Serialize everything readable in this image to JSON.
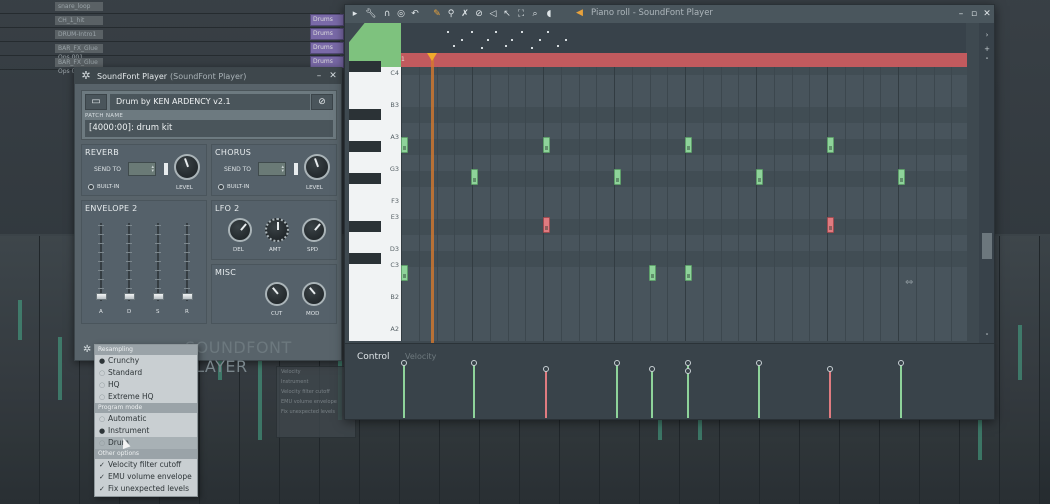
{
  "sfp": {
    "title": "SoundFont Player",
    "subtitle": "(SoundFont Player)",
    "soundfont_name": "Drum by KEN ARDENCY v2.1",
    "patch_label": "PATCH NAME",
    "patch_value": "[4000:00]: drum kit",
    "reverb": {
      "header": "REVERB",
      "send_to": "SEND TO",
      "builtin": "BUILT-IN",
      "level": "LEVEL"
    },
    "chorus": {
      "header": "CHORUS",
      "send_to": "SEND TO",
      "builtin": "BUILT-IN",
      "level": "LEVEL"
    },
    "envelope": {
      "header": "ENVELOPE 2",
      "labels": [
        "A",
        "D",
        "S",
        "R"
      ]
    },
    "lfo": {
      "header": "LFO 2",
      "knobs": [
        "DEL",
        "AMT",
        "SPD"
      ]
    },
    "misc": {
      "header": "MISC",
      "knobs": [
        "CUT",
        "MOD"
      ]
    },
    "brand_a": "SOUNDFONT",
    "brand_b": "PLAYER"
  },
  "menu": {
    "sections": [
      {
        "header": "Resampling",
        "items": [
          {
            "label": "Crunchy",
            "mark": "radio-on"
          },
          {
            "label": "Standard",
            "mark": "radio-off"
          },
          {
            "label": "HQ",
            "mark": "radio-off"
          },
          {
            "label": "Extreme HQ",
            "mark": "radio-off"
          }
        ]
      },
      {
        "header": "Program mode",
        "items": [
          {
            "label": "Automatic",
            "mark": "radio-off"
          },
          {
            "label": "Instrument",
            "mark": "radio-on"
          },
          {
            "label": "Drum",
            "mark": "radio-off",
            "highlighted": true
          }
        ]
      },
      {
        "header": "Other options",
        "items": [
          {
            "label": "Velocity filter cutoff",
            "mark": "check"
          },
          {
            "label": "EMU volume envelope",
            "mark": "check"
          },
          {
            "label": "Fix unexpected levels",
            "mark": "check"
          }
        ]
      }
    ]
  },
  "piano_roll": {
    "title": "Piano roll - SoundFont Player",
    "ruler_start": "1",
    "key_labels": [
      "C4",
      "B3",
      "A3",
      "G3",
      "F3",
      "E3",
      "D3",
      "C3",
      "B2",
      "A2"
    ],
    "control_label": "Control",
    "control_target": "Velocity"
  },
  "background": {
    "rows": [
      "snare_loop",
      "CH_1_hit",
      "DRUM-Intro1",
      "BAR_FX_Glue Ops 001",
      "BAR_FX_Glue Ops 002"
    ],
    "purple_clips": [
      "Drums",
      "Drums",
      "Drums",
      "Drums"
    ],
    "float_menu": [
      "Velocity",
      "Instrument",
      "Velocity filter cutoff",
      "EMU volume envelope",
      "Fix unexpected levels"
    ]
  },
  "colors": {
    "note_green": "#8ed39a",
    "note_red": "#e07b80",
    "ruler": "#c25a5e",
    "playhead": "#f0a92b"
  }
}
